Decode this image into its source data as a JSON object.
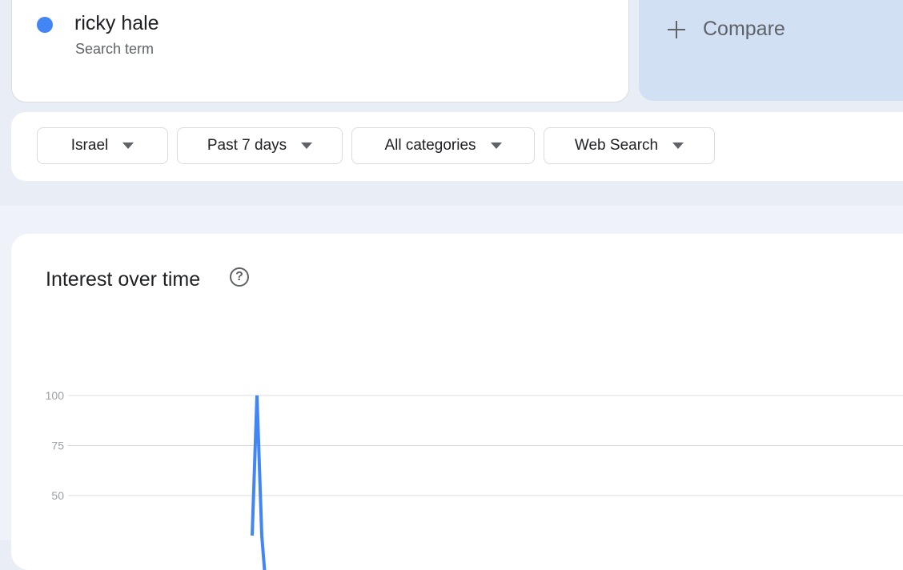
{
  "search_term": {
    "name": "ricky hale",
    "type_label": "Search term",
    "color": "#4285f4"
  },
  "compare": {
    "label": "Compare",
    "icon": "plus-icon"
  },
  "filters": [
    {
      "label": "Israel"
    },
    {
      "label": "Past 7 days"
    },
    {
      "label": "All categories"
    },
    {
      "label": "Web Search"
    }
  ],
  "interest_over_time": {
    "title": "Interest over time",
    "help_icon": "help-circle-icon"
  },
  "chart_data": {
    "type": "line",
    "title": "Interest over time",
    "yticks": [
      "100",
      "75",
      "50"
    ],
    "ylim": [
      0,
      100
    ],
    "grid": true,
    "series": [
      {
        "color": "#4285f4",
        "x": [
          0,
          1,
          2,
          3
        ],
        "values": [
          30,
          100,
          30,
          0
        ]
      }
    ]
  }
}
